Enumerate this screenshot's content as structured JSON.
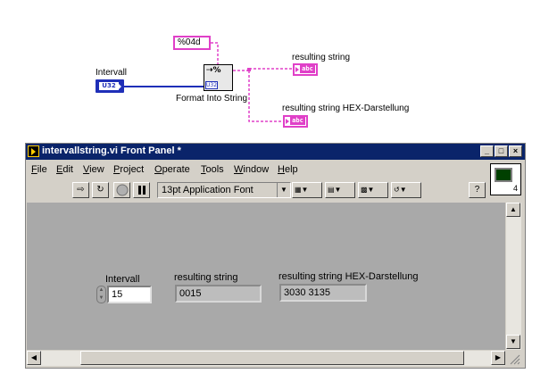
{
  "block_diagram": {
    "format_constant": "%04d",
    "intervall_label": "Intervall",
    "intervall_type": "U32",
    "node_label": "Format Into String",
    "node_icon_text": "⇢%",
    "node_input_type": "U32",
    "out1_label": "resulting string",
    "out2_label": "resulting string HEX-Darstellung",
    "string_type": "abc"
  },
  "window": {
    "title": "intervallstring.vi Front Panel *",
    "caption_buttons": [
      "_",
      "□",
      "×"
    ],
    "menu": [
      "File",
      "Edit",
      "View",
      "Project",
      "Operate",
      "Tools",
      "Window",
      "Help"
    ],
    "font_selector": "13pt Application Font",
    "connector_number": "4",
    "help_glyph": "?"
  },
  "front_panel": {
    "intervall_label": "Intervall",
    "intervall_value": "15",
    "resulting_string_label": "resulting string",
    "resulting_string_value": "0015",
    "hex_label": "resulting string HEX-Darstellung",
    "hex_value": "3030 3135"
  },
  "colors": {
    "string_wire": "#e040c8",
    "integer_wire": "#1f2fb8",
    "title_bar": "#0a246a",
    "panel_bg": "#a9a9a9"
  },
  "icons": [
    "run-arrow-icon",
    "run-continuously-icon",
    "abort-icon",
    "pause-icon",
    "align-icon",
    "distribute-icon",
    "resize-icon",
    "reorder-icon",
    "help-icon",
    "connector-pane-icon"
  ]
}
